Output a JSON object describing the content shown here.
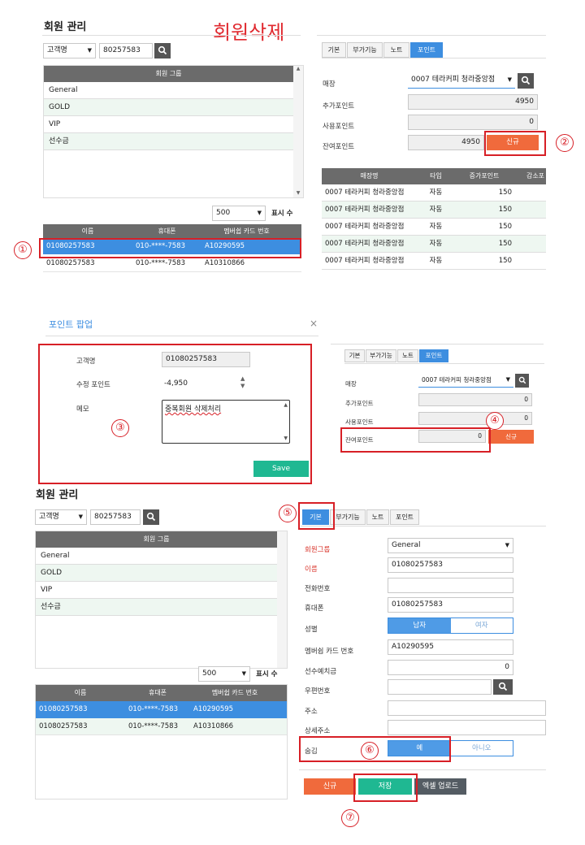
{
  "overlay_title": "회원삭제",
  "top": {
    "title": "회원 관리",
    "search_type": "고객명",
    "search_value": "80257583",
    "group_header": "회원 그룹",
    "groups": [
      "General",
      "GOLD",
      "VIP",
      "선수금"
    ],
    "page_size": "500",
    "page_size_label": "표시 수",
    "member_headers": [
      "이름",
      "휴대폰",
      "멤버쉽 카드 번호"
    ],
    "members": [
      {
        "name": "01080257583",
        "phone": "010-****-7583",
        "card": "A10290595"
      },
      {
        "name": "01080257583",
        "phone": "010-****-7583",
        "card": "A10310866"
      }
    ],
    "tabs": [
      "기본",
      "부가기능",
      "노트",
      "포인트"
    ],
    "store_label": "매장",
    "store_value": "0007 테라커피 청라중앙점",
    "add_label": "추가포인트",
    "add_value": "4950",
    "use_label": "사용포인트",
    "use_value": "0",
    "remain_label": "잔여포인트",
    "remain_value": "4950",
    "new_button": "신규",
    "points_headers": [
      "매장명",
      "타입",
      "증가포인트",
      "감소포"
    ],
    "points_rows": [
      {
        "store": "0007 테라커피 청라중앙점",
        "type": "자동",
        "plus": "150"
      },
      {
        "store": "0007 테라커피 청라중앙점",
        "type": "자동",
        "plus": "150"
      },
      {
        "store": "0007 테라커피 청라중앙점",
        "type": "자동",
        "plus": "150"
      },
      {
        "store": "0007 테라커피 청라중앙점",
        "type": "자동",
        "plus": "150"
      },
      {
        "store": "0007 테라커피 청라중앙점",
        "type": "자동",
        "plus": "150"
      }
    ]
  },
  "popup": {
    "title": "포인트 팝업",
    "close": "×",
    "name_label": "고객명",
    "name_value": "01080257583",
    "edit_label": "수정 포인트",
    "edit_value": "-4,950",
    "memo_label": "메모",
    "memo_value": "중복회원 삭제처리",
    "save": "Save"
  },
  "mid": {
    "tabs": [
      "기본",
      "부가기능",
      "노트",
      "포인트"
    ],
    "store_label": "매장",
    "store_value": "0007 테라커피 청라중앙점",
    "add_label": "추가포인트",
    "add_value": "0",
    "use_label": "사용포인트",
    "use_value": "0",
    "remain_label": "잔여포인트",
    "remain_value": "0",
    "new_button": "신규"
  },
  "bottom": {
    "title": "회원 관리",
    "search_type": "고객명",
    "search_value": "80257583",
    "group_header": "회원 그룹",
    "groups": [
      "General",
      "GOLD",
      "VIP",
      "선수금"
    ],
    "page_size": "500",
    "page_size_label": "표시 수",
    "member_headers": [
      "이름",
      "휴대폰",
      "멤버쉽 카드 번호"
    ],
    "members": [
      {
        "name": "01080257583",
        "phone": "010-****-7583",
        "card": "A10290595"
      },
      {
        "name": "01080257583",
        "phone": "010-****-7583",
        "card": "A10310866"
      }
    ],
    "tabs": [
      "기본",
      "부가기능",
      "노트",
      "포인트"
    ],
    "form": {
      "group_label": "회원그룹",
      "group_value": "General",
      "name_label": "이름",
      "name_value": "01080257583",
      "tel_label": "전화번호",
      "tel_value": "",
      "mobile_label": "휴대폰",
      "mobile_value": "01080257583",
      "gender_label": "성별",
      "male": "남자",
      "female": "여자",
      "card_label": "멤버쉽 카드 번호",
      "card_value": "A10290595",
      "deposit_label": "선수예치금",
      "deposit_value": "0",
      "zip_label": "우편번호",
      "addr_label": "주소",
      "addr2_label": "상세주소",
      "hide_label": "숨김",
      "yes": "예",
      "no": "아니오"
    },
    "btn_new": "신규",
    "btn_save": "저장",
    "btn_excel": "엑셀 업로드"
  },
  "markers": [
    "①",
    "②",
    "③",
    "④",
    "⑤",
    "⑥",
    "⑦"
  ],
  "colors": {
    "accent": "#3d8ee0",
    "highlight": "#d71f26",
    "orange": "#f06a3c",
    "green": "#1fb892"
  }
}
